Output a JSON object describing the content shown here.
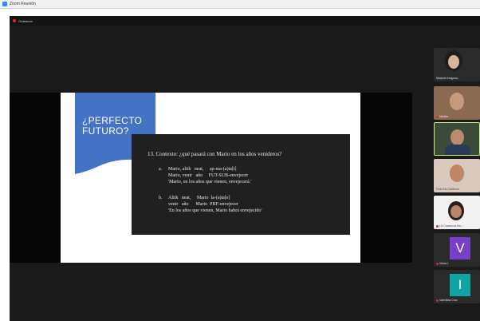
{
  "window": {
    "title": "Zoom Reunión"
  },
  "topbar": {
    "recording_label": "Grabando"
  },
  "slide": {
    "title_line1": "¿PERFECTO",
    "title_line2": "FUTURO?",
    "example": {
      "heading": "13.  Contexto: ¿qué pasará con Mario en los años venideros?",
      "a_label": "a.",
      "a_line1": "Mario, aliik   neat,     ap-ma-(a)ta[t]",
      "a_line2": "Mario, venir   año     FUT-SUB-envejecer",
      "a_line3": "'Mario, en los años que vienen, envejecerá.'",
      "b_label": "b.",
      "b_line1": "Aliik   neat,     Mario  la-(a)ta[e]",
      "b_line2": "venir   año      Mario  PRF-envejecer",
      "b_line3": "'En los años que vienen, Mario habrá envejecido'"
    }
  },
  "participants": [
    {
      "name": "Marjorie Aragona...",
      "type": "video",
      "active": false
    },
    {
      "name": "Natalia",
      "type": "video",
      "active": false
    },
    {
      "name": "",
      "type": "video",
      "active": true
    },
    {
      "name": "Frida Mo Calderón",
      "type": "video",
      "active": false
    },
    {
      "name": "Lili Casanova Ma...",
      "type": "video",
      "active": false
    },
    {
      "name": "Vilma L",
      "type": "letter",
      "letter": "V",
      "color": "#7a3fc8",
      "active": false
    },
    {
      "name": "Valentina Cruz",
      "type": "letter",
      "letter": "I",
      "color": "#0fa3a3",
      "active": false
    }
  ],
  "colors": {
    "slide_accent": "#4472c4",
    "tile_active": "#c8f56b",
    "mic_muted": "#e02828"
  }
}
